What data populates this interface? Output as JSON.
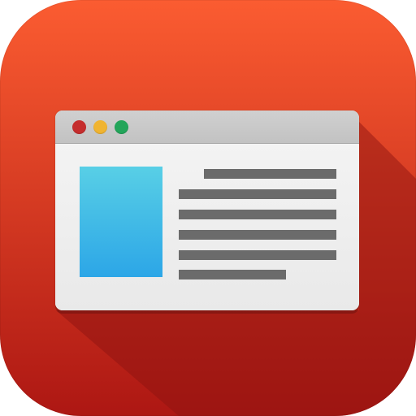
{
  "icon": {
    "name": "web-browser-app-icon",
    "colors": {
      "gradient_top": "#fb5c31",
      "gradient_bottom": "#ad1713",
      "long_shadow": "#8c1310",
      "window_background": "#ececec",
      "title_bar": "#c2c2c2",
      "close_dot": "#c52d2d",
      "minimize_dot": "#f0b431",
      "maximize_dot": "#23a55a",
      "image_placeholder_top": "#58cfe6",
      "image_placeholder_bottom": "#2ca6e7",
      "text_line": "#6b6b6b"
    }
  },
  "window": {
    "title_bar": {
      "buttons": [
        {
          "icon": "close-dot-icon",
          "color": "#c52d2d"
        },
        {
          "icon": "minimize-dot-icon",
          "color": "#f0b431"
        },
        {
          "icon": "maximize-dot-icon",
          "color": "#23a55a"
        }
      ]
    },
    "content": {
      "image_placeholder_icon": "image-placeholder-icon",
      "text_lines_count": 6
    }
  }
}
